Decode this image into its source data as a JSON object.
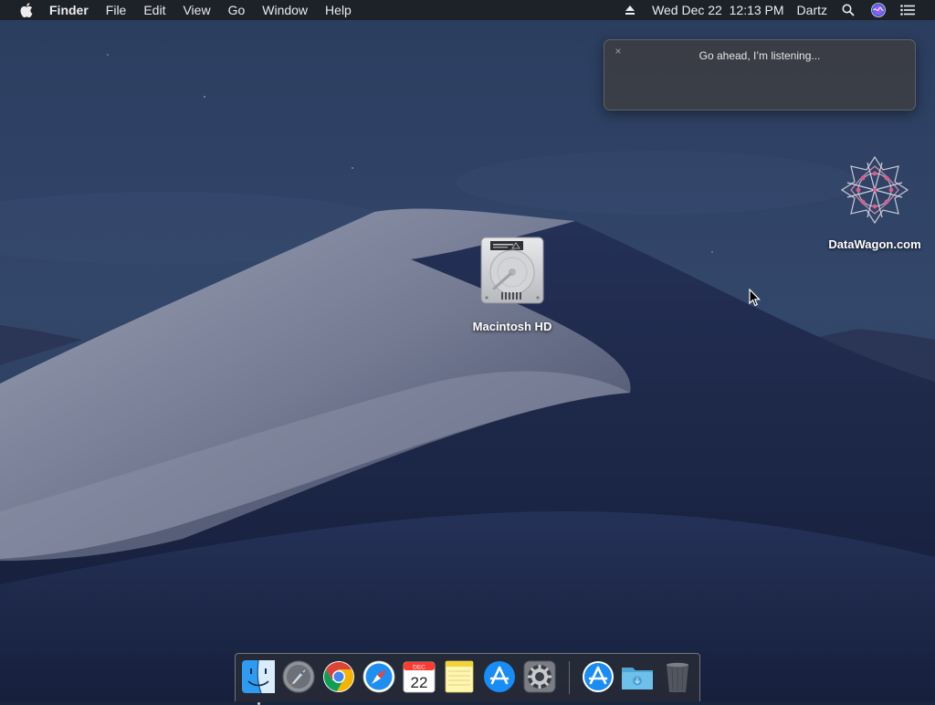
{
  "menubar": {
    "app_name": "Finder",
    "menus": [
      "File",
      "Edit",
      "View",
      "Go",
      "Window",
      "Help"
    ],
    "clock": "Wed Dec 22  12:13 PM",
    "user": "Dartz",
    "icons": [
      "apple-icon",
      "eject-icon",
      "spotlight-icon",
      "siri-icon",
      "notification-center-icon"
    ]
  },
  "siri": {
    "close_glyph": "×",
    "prompt": "Go ahead, I’m listening..."
  },
  "desktop": {
    "icons": [
      {
        "label": "Macintosh HD",
        "icon": "hard-drive-icon"
      },
      {
        "label": "DataWagon.com",
        "icon": "datawagon-logo-icon"
      }
    ]
  },
  "dock": {
    "calendar_month": "DEC",
    "calendar_day": "22",
    "items": [
      "finder-icon",
      "launchpad-icon",
      "chrome-icon",
      "safari-icon",
      "calendar-icon",
      "notes-icon",
      "app-store-icon",
      "system-preferences-icon",
      "app-store-downloads-icon",
      "downloads-folder-icon",
      "trash-icon"
    ]
  },
  "colors": {
    "menubar_bg": "#1c1e24",
    "sky": "#2a3a5c",
    "dune_light": "#8e93a6",
    "dune_dark": "#1c2748"
  }
}
